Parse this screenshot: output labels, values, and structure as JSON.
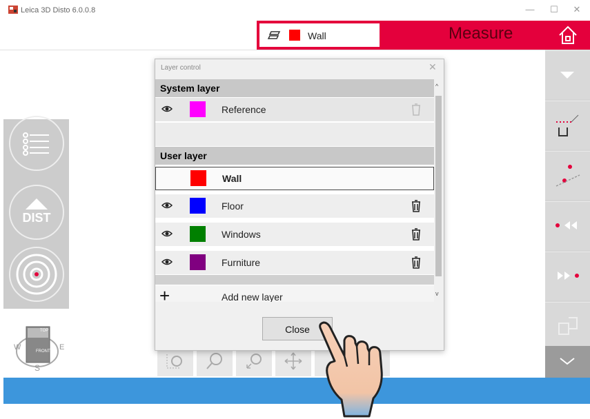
{
  "window": {
    "title": "Leica 3D Disto 6.0.0.8",
    "minimize": "—",
    "maximize": "☐",
    "close": "✕"
  },
  "header": {
    "current_layer": "Wall",
    "current_layer_color": "#ff0000",
    "mode_label": "Measure",
    "accent": "#e4003c"
  },
  "left_panel": {
    "dist_label": "DIST"
  },
  "compass": {
    "top": "TOP",
    "front": "FRONT",
    "west": "W",
    "east": "E",
    "south": "S"
  },
  "dialog": {
    "title": "Layer control",
    "system_section": "System layer",
    "system_layers": [
      {
        "name": "Reference",
        "color": "#ff00ff"
      }
    ],
    "user_section": "User layer",
    "user_layers": [
      {
        "name": "Wall",
        "color": "#ff0000",
        "selected": true
      },
      {
        "name": "Floor",
        "color": "#0000ff"
      },
      {
        "name": "Windows",
        "color": "#008000"
      },
      {
        "name": "Furniture",
        "color": "#800080"
      }
    ],
    "add_label": "Add new layer",
    "add_symbol": "+",
    "close_label": "Close"
  },
  "icons": [
    "app-icon",
    "layers-icon",
    "home-icon",
    "eye-icon",
    "trash-icon",
    "list-icon",
    "dist-icon",
    "target-icon",
    "compass-icon",
    "chevron-down-icon",
    "scroll-up-icon",
    "scroll-down-icon",
    "hand-pointer-icon"
  ]
}
